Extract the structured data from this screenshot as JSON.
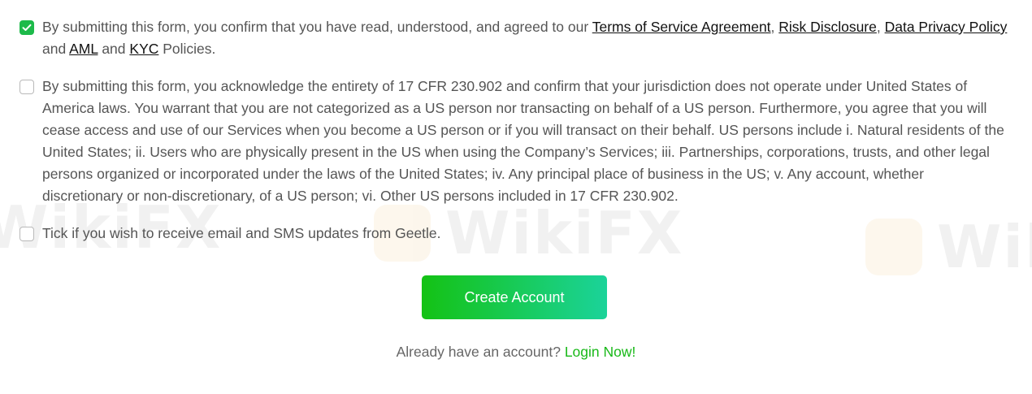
{
  "consents": [
    {
      "checked": true,
      "text_before": "By submitting this form, you confirm that you have read, understood, and agreed to our ",
      "link_terms": "Terms of Service Agreement",
      "sep1": ", ",
      "link_risk": "Risk Disclosure",
      "sep2": ", ",
      "link_privacy": "Data Privacy Policy",
      "sep3": " and ",
      "link_aml": "AML",
      "sep4": " and ",
      "link_kyc": "KYC",
      "text_after": " Policies."
    },
    {
      "checked": false,
      "text": "By submitting this form, you acknowledge the entirety of 17 CFR 230.902 and confirm that your jurisdiction does not operate under United States of America laws. You warrant that you are not categorized as a US person nor transacting on behalf of a US person. Furthermore, you agree that you will cease access and use of our Services when you become a US person or if you will transact on their behalf. US persons include i. Natural residents of the United States; ii. Users who are physically present in the US when using the Company’s Services; iii. Partnerships, corporations, trusts, and other legal persons organized or incorporated under the laws of the United States; iv. Any principal place of business in the US; v. Any account, whether discretionary or non-discretionary, of a US person; vi. Other US persons included in 17 CFR 230.902."
    },
    {
      "checked": false,
      "text": "Tick if you wish to receive email and SMS updates from Geetle."
    }
  ],
  "create_button_label": "Create Account",
  "login": {
    "prompt": "Already have an account? ",
    "link_label": "Login Now!"
  },
  "watermark_text": "WikiFX",
  "colors": {
    "accent_green": "#1dba4a",
    "button_gradient_start": "#14c214",
    "button_gradient_end": "#1bd39a",
    "link_green": "#19b919"
  },
  "icons": {
    "checked": "checkmark-icon"
  }
}
